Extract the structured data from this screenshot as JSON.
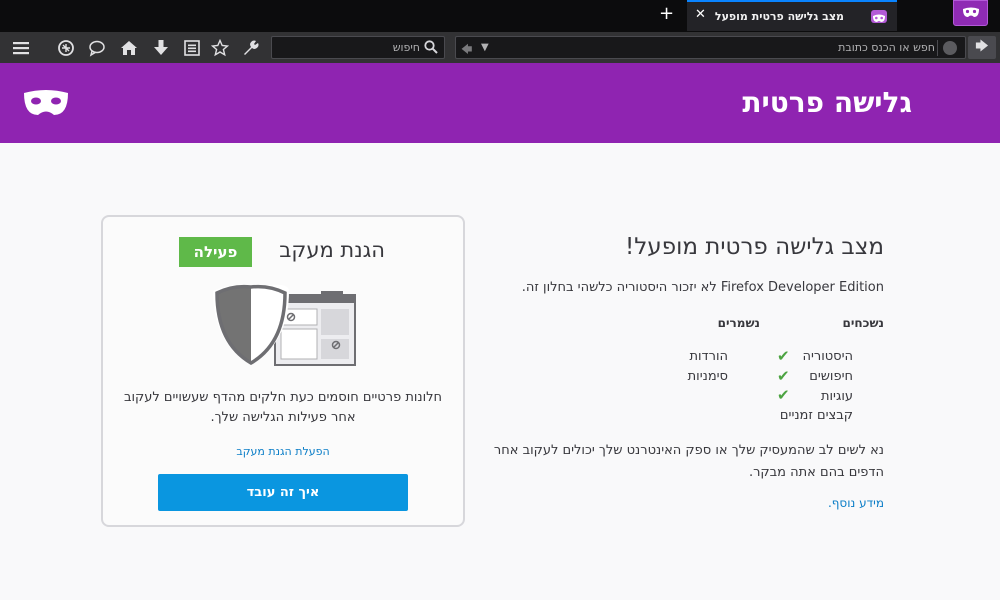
{
  "tabstrip": {
    "tab_title": "מצב גלישה פרטית מופעל",
    "close_glyph": "✕",
    "new_tab_glyph": "+"
  },
  "navbar": {
    "url_placeholder": "חפש או הכנס כתובת",
    "search_placeholder": "חיפוש",
    "forward_glyph": "🡆",
    "back_glyph": "🡄",
    "dropdown_glyph": "▼"
  },
  "header": {
    "title": "גלישה פרטית"
  },
  "main": {
    "title": "מצב גלישה פרטית מופעל!",
    "description_brand": "Firefox Developer Edition",
    "description_rest": " לא יזכור היסטוריה כלשהי בחלון זה.",
    "forgotten_header": "נשכחים",
    "kept_header": "נשמרים",
    "forgotten_items": [
      "היסטוריה",
      "חיפושים",
      "עוגיות",
      "קבצים זמניים"
    ],
    "kept_items": [
      "הורדות",
      "סימניות"
    ],
    "check_glyph": "✔",
    "note": "נא לשים לב שהמעסיק שלך או ספק האינטרנט שלך יכולים לעקוב אחר הדפים בהם אתה מבקר.",
    "learn_more": "מידע נוסף."
  },
  "tracking": {
    "title": "הגנת מעקב",
    "status": "פעילה",
    "text": "חלונות פרטיים חוסמים כעת חלקים מהדף שעשויים לעקוב אחר פעילות הגלישה שלך.",
    "link": "הפעלת הגנת מעקב",
    "button": "איך זה עובד"
  },
  "colors": {
    "accent_purple": "#8f24b1",
    "link_blue": "#0a7dc7",
    "button_blue": "#0a96e0",
    "badge_green": "#5fb949",
    "check_green": "#4ca341"
  }
}
